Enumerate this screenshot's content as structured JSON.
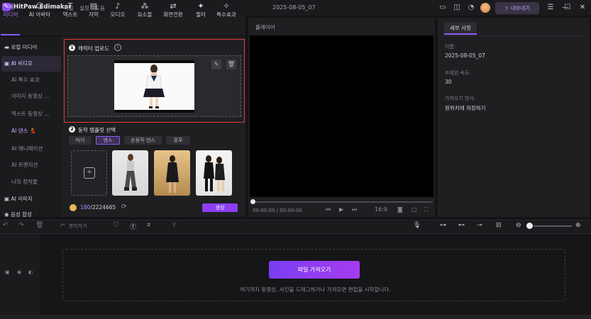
{
  "titlebar": {
    "app_title": "HitPaw Edimakor",
    "menu": [
      "파일",
      "설정",
      "도움"
    ],
    "project_title": "2025-08-05_07",
    "export_label": "내보내기"
  },
  "toolbar": {
    "tools": [
      {
        "label": "미디어",
        "icon": "folder-icon"
      },
      {
        "label": "AI 아바타",
        "icon": "avatar-icon"
      },
      {
        "label": "텍스트",
        "icon": "text-icon"
      },
      {
        "label": "자막",
        "icon": "subtitle-icon"
      },
      {
        "label": "오디오",
        "icon": "music-icon"
      },
      {
        "label": "요소들",
        "icon": "elements-icon"
      },
      {
        "label": "화면전환",
        "icon": "transition-icon"
      },
      {
        "label": "필터",
        "icon": "filter-icon"
      },
      {
        "label": "특수효과",
        "icon": "effects-icon"
      }
    ]
  },
  "sidebar": {
    "items": [
      {
        "label": "로컬 미디어"
      },
      {
        "label": "AI 비디오"
      },
      {
        "label": "AI 특수 효과"
      },
      {
        "label": "이미지 동영상 ..."
      },
      {
        "label": "텍스트 동영상 ..."
      },
      {
        "label": "AI 댄스 💃"
      },
      {
        "label": "AI 애니메이션"
      },
      {
        "label": "AI 트랜지션"
      },
      {
        "label": "나의 창작물"
      },
      {
        "label": "AI 이미지"
      },
      {
        "label": "음성 합성"
      }
    ]
  },
  "center": {
    "step1_num": "1",
    "step1_title": "캐릭터 업로드",
    "step2_num": "2",
    "step2_title": "동작 템플릿 선택",
    "categories": [
      "마이",
      "댄스",
      "손동작 댄스",
      "쿵푸"
    ],
    "credits_used": "180",
    "credits_total": "/2224665",
    "generate_label": "생성"
  },
  "player": {
    "label": "플레이어",
    "timecode": "00:00:00 / 00:00:00",
    "aspect": "16:9"
  },
  "details": {
    "tab_label": "세부 사항",
    "fields": [
      {
        "label": "이름:",
        "value": "2025-08-05_07"
      },
      {
        "label": "프레임 속도:",
        "value": "30"
      },
      {
        "label": "가져오기 방식:",
        "value": "원위치에 저장하기"
      }
    ]
  },
  "timeline": {
    "split_label": "분리하기",
    "import_label": "파일 가져오기",
    "drop_hint": "여기까지 동영상, 사진을 드래그하거나 가져오면 편집을 시작합니다."
  },
  "colors": {
    "accent": "#8b5cf6",
    "highlight_border": "#e23a3a",
    "generate_button": "#8b3ff5"
  }
}
